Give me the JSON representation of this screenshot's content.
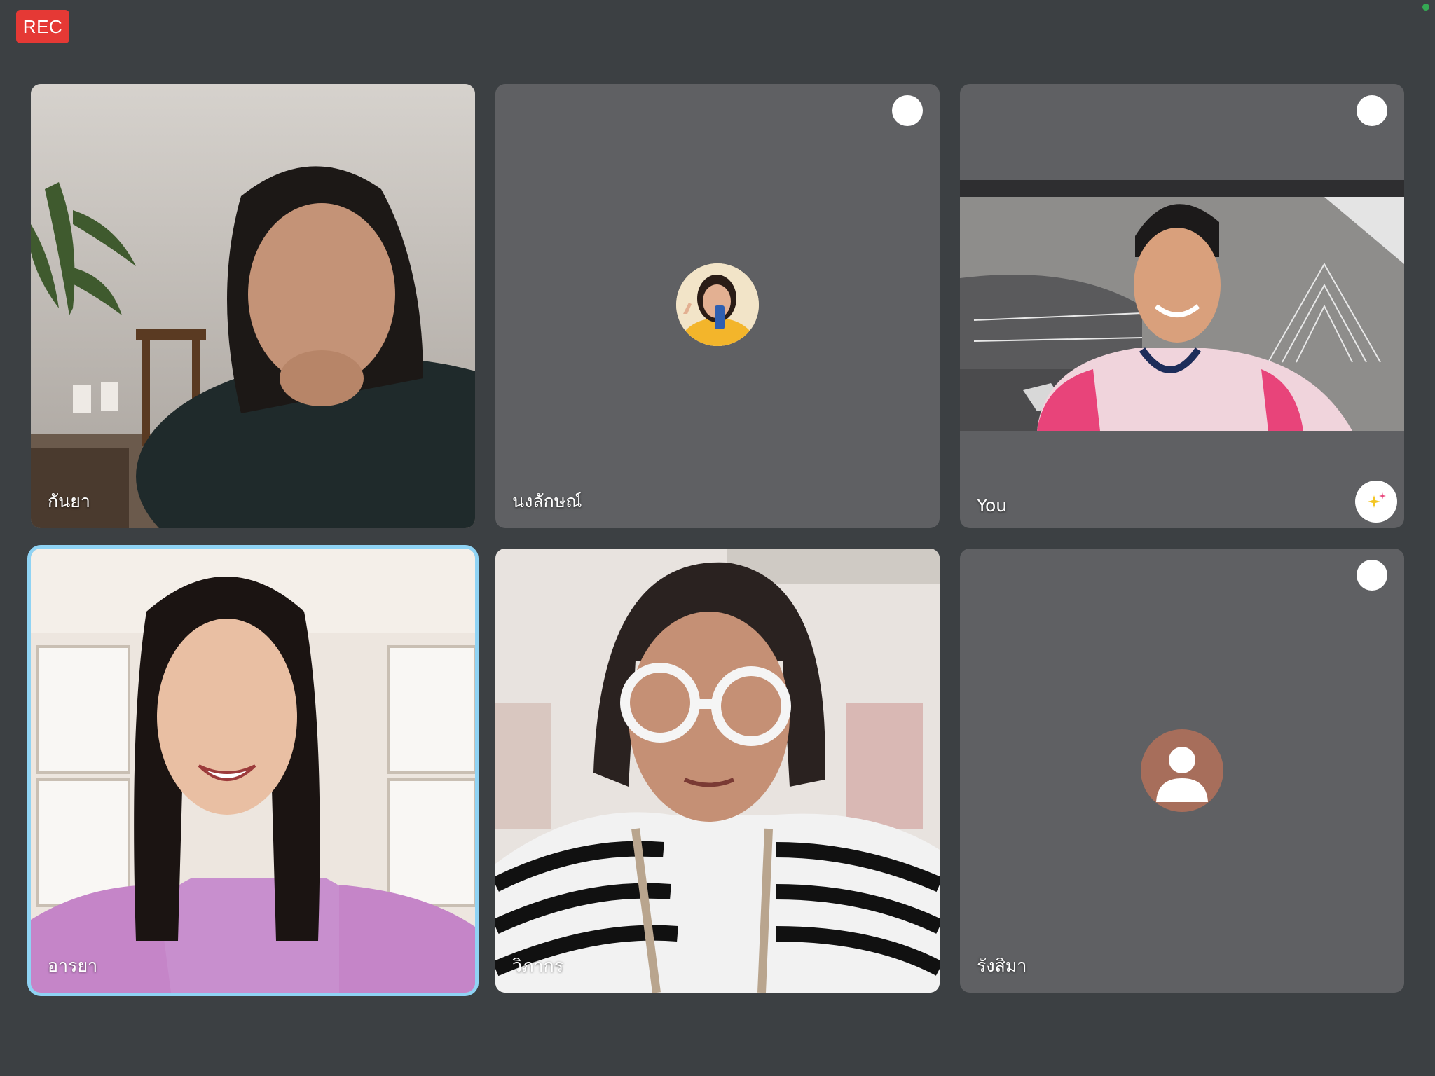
{
  "recording": {
    "label": "REC",
    "color": "#e53935"
  },
  "participants": [
    {
      "name": "กันยา",
      "camera": "on"
    },
    {
      "name": "นงลักษณ์",
      "camera": "off",
      "avatar": "profile-photo"
    },
    {
      "name": "You",
      "camera": "on",
      "is_self": true
    },
    {
      "name": "อารยา",
      "camera": "on",
      "active_speaker": true
    },
    {
      "name": "วิภากร",
      "camera": "on"
    },
    {
      "name": "รังสิมา",
      "camera": "off",
      "avatar": "default-person-icon"
    }
  ],
  "colors": {
    "background": "#3c4043",
    "tile": "#5f6063",
    "active_speaker_border": "#8fd3f4",
    "default_avatar": "#a76e5b",
    "status": "#34a853"
  }
}
